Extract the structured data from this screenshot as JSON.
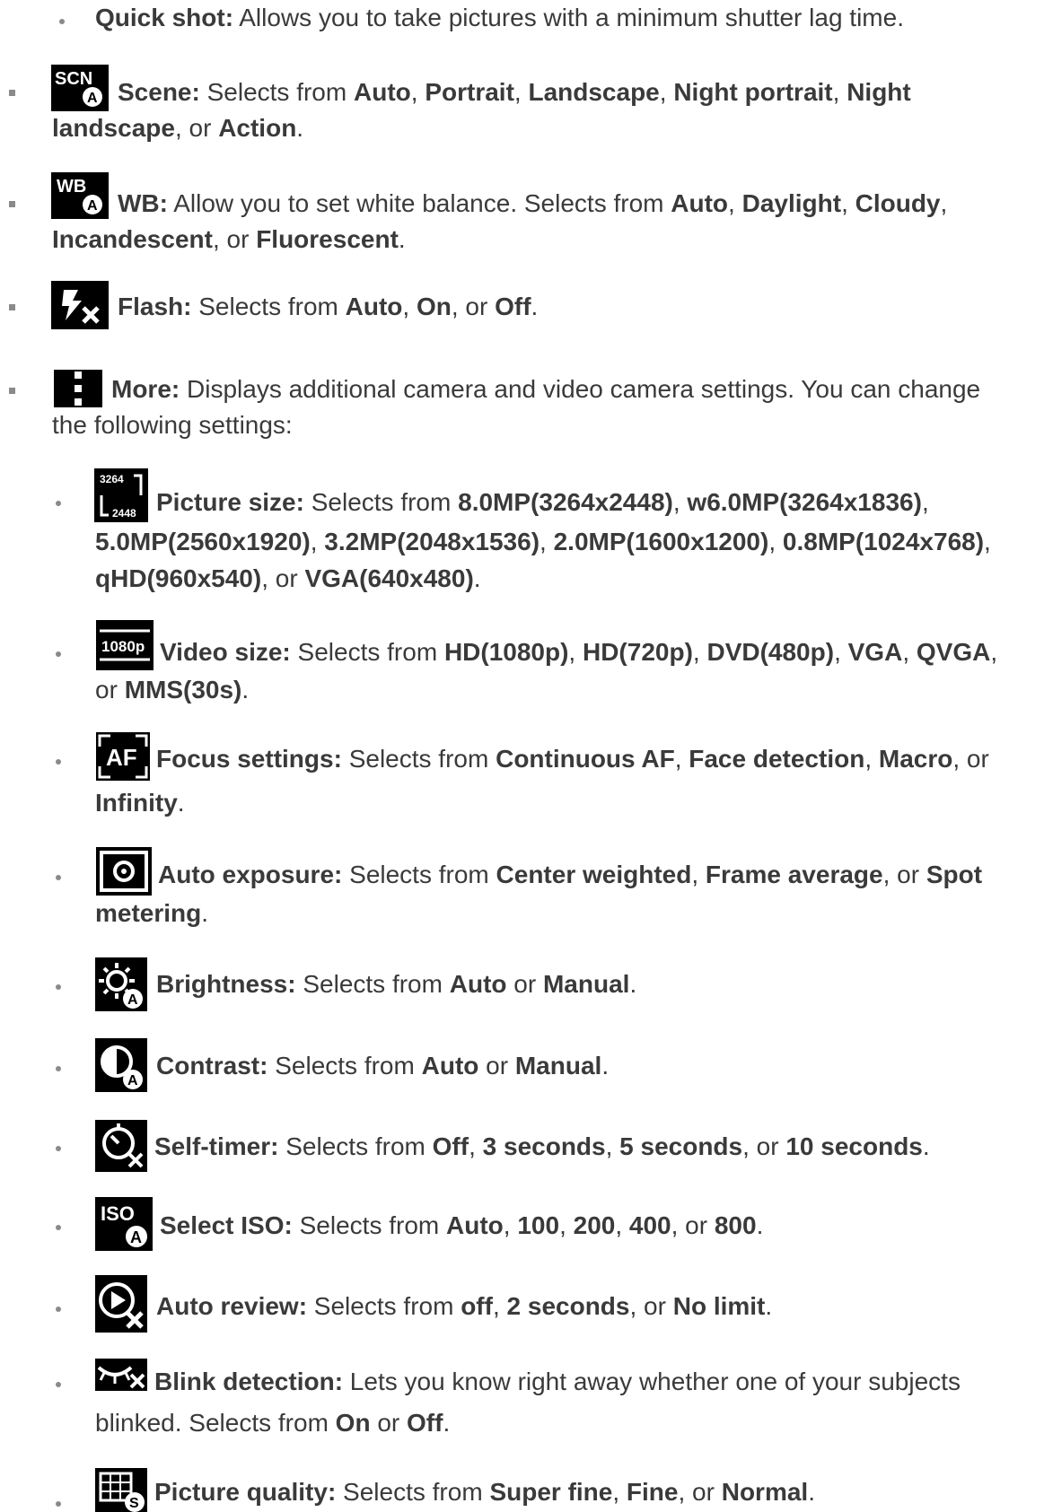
{
  "items": [
    {
      "key": "quick",
      "parts": [
        {
          "b": true,
          "t": "Quick shot:"
        },
        {
          "t": " Allows you to take pictures with a minimum shutter lag time."
        }
      ]
    },
    {
      "key": "scene",
      "icon": "scene-icon",
      "icon_text": "SCN",
      "line1": [
        {
          "b": true,
          "t": "Scene:"
        },
        {
          "t": " Selects from "
        },
        {
          "b": true,
          "t": "Auto"
        },
        {
          "t": ", "
        },
        {
          "b": true,
          "t": "Portrait"
        },
        {
          "t": ", "
        },
        {
          "b": true,
          "t": "Landscape"
        },
        {
          "t": ", "
        },
        {
          "b": true,
          "t": "Night portrait"
        },
        {
          "t": ", "
        },
        {
          "b": true,
          "t": "Night"
        }
      ],
      "line2": [
        {
          "b": true,
          "t": "landscape"
        },
        {
          "t": ", or "
        },
        {
          "b": true,
          "t": "Action"
        },
        {
          "t": "."
        }
      ]
    },
    {
      "key": "wb",
      "icon": "white-balance-icon",
      "icon_text": "WB",
      "line1": [
        {
          "b": true,
          "t": "WB:"
        },
        {
          "t": " Allow you to set white balance. Selects from "
        },
        {
          "b": true,
          "t": "Auto"
        },
        {
          "t": ", "
        },
        {
          "b": true,
          "t": "Daylight"
        },
        {
          "t": ", "
        },
        {
          "b": true,
          "t": "Cloudy"
        },
        {
          "t": ","
        }
      ],
      "line2": [
        {
          "b": true,
          "t": "Incandescent"
        },
        {
          "t": ", or "
        },
        {
          "b": true,
          "t": "Fluorescent"
        },
        {
          "t": "."
        }
      ]
    },
    {
      "key": "flash",
      "icon": "flash-off-icon",
      "line1": [
        {
          "b": true,
          "t": "Flash:"
        },
        {
          "t": " Selects from "
        },
        {
          "b": true,
          "t": "Auto"
        },
        {
          "t": ", "
        },
        {
          "b": true,
          "t": "On"
        },
        {
          "t": ", or "
        },
        {
          "b": true,
          "t": "Off"
        },
        {
          "t": "."
        }
      ]
    },
    {
      "key": "more",
      "icon": "more-vertical-icon",
      "line1": [
        {
          "b": true,
          "t": "More:"
        },
        {
          "t": " Displays additional camera and video camera settings. You can change"
        }
      ],
      "line2": [
        {
          "t": "the following settings:"
        }
      ]
    },
    {
      "key": "picsize",
      "icon": "picture-size-icon",
      "icon_text": "3264",
      "icon_text2": "2448",
      "line1": [
        {
          "b": true,
          "t": "Picture size:"
        },
        {
          "t": " Selects from "
        },
        {
          "b": true,
          "t": "8.0MP(3264x2448)"
        },
        {
          "t": ", "
        },
        {
          "b": true,
          "t": "w6.0MP(3264x1836)"
        },
        {
          "t": ","
        }
      ],
      "line2": [
        {
          "b": true,
          "t": "5.0MP(2560x1920)"
        },
        {
          "t": ", "
        },
        {
          "b": true,
          "t": "3.2MP(2048x1536)"
        },
        {
          "t": ", "
        },
        {
          "b": true,
          "t": "2.0MP(1600x1200)"
        },
        {
          "t": ", "
        },
        {
          "b": true,
          "t": "0.8MP(1024x768)"
        },
        {
          "t": ","
        }
      ],
      "line3": [
        {
          "b": true,
          "t": "qHD(960x540)"
        },
        {
          "t": ", or "
        },
        {
          "b": true,
          "t": "VGA(640x480)"
        },
        {
          "t": "."
        }
      ]
    },
    {
      "key": "vidsize",
      "icon": "video-size-icon",
      "icon_text": "1080p",
      "line1": [
        {
          "b": true,
          "t": "Video size:"
        },
        {
          "t": " Selects from "
        },
        {
          "b": true,
          "t": "HD(1080p)"
        },
        {
          "t": ", "
        },
        {
          "b": true,
          "t": "HD(720p)"
        },
        {
          "t": ", "
        },
        {
          "b": true,
          "t": "DVD(480p)"
        },
        {
          "t": ", "
        },
        {
          "b": true,
          "t": "VGA"
        },
        {
          "t": ", "
        },
        {
          "b": true,
          "t": "QVGA"
        },
        {
          "t": ","
        }
      ],
      "line2": [
        {
          "t": "or "
        },
        {
          "b": true,
          "t": "MMS(30s)"
        },
        {
          "t": "."
        }
      ]
    },
    {
      "key": "focus",
      "icon": "focus-icon",
      "icon_text": "AF",
      "line1": [
        {
          "b": true,
          "t": "Focus settings:"
        },
        {
          "t": " Selects from "
        },
        {
          "b": true,
          "t": "Continuous AF"
        },
        {
          "t": ", "
        },
        {
          "b": true,
          "t": "Face detection"
        },
        {
          "t": ", "
        },
        {
          "b": true,
          "t": "Macro"
        },
        {
          "t": ", or"
        }
      ],
      "line2": [
        {
          "b": true,
          "t": "Infinity"
        },
        {
          "t": "."
        }
      ]
    },
    {
      "key": "exposure",
      "icon": "auto-exposure-icon",
      "line1": [
        {
          "b": true,
          "t": "Auto exposure:"
        },
        {
          "t": " Selects from "
        },
        {
          "b": true,
          "t": "Center weighted"
        },
        {
          "t": ", "
        },
        {
          "b": true,
          "t": "Frame average"
        },
        {
          "t": ", or "
        },
        {
          "b": true,
          "t": "Spot"
        }
      ],
      "line2": [
        {
          "b": true,
          "t": "metering"
        },
        {
          "t": "."
        }
      ]
    },
    {
      "key": "brightness",
      "icon": "brightness-icon",
      "line1": [
        {
          "b": true,
          "t": "Brightness:"
        },
        {
          "t": " Selects from "
        },
        {
          "b": true,
          "t": "Auto"
        },
        {
          "t": " or "
        },
        {
          "b": true,
          "t": "Manual"
        },
        {
          "t": "."
        }
      ]
    },
    {
      "key": "contrast",
      "icon": "contrast-icon",
      "line1": [
        {
          "b": true,
          "t": "Contrast:"
        },
        {
          "t": " Selects from "
        },
        {
          "b": true,
          "t": "Auto"
        },
        {
          "t": " or "
        },
        {
          "b": true,
          "t": "Manual"
        },
        {
          "t": "."
        }
      ]
    },
    {
      "key": "timer",
      "icon": "self-timer-icon",
      "line1": [
        {
          "b": true,
          "t": "Self-timer:"
        },
        {
          "t": " Selects from "
        },
        {
          "b": true,
          "t": "Off"
        },
        {
          "t": ", "
        },
        {
          "b": true,
          "t": "3 seconds"
        },
        {
          "t": ", "
        },
        {
          "b": true,
          "t": "5 seconds"
        },
        {
          "t": ", or "
        },
        {
          "b": true,
          "t": "10 seconds"
        },
        {
          "t": "."
        }
      ]
    },
    {
      "key": "iso",
      "icon": "iso-icon",
      "icon_text": "ISO",
      "line1": [
        {
          "b": true,
          "t": "Select ISO:"
        },
        {
          "t": " Selects from "
        },
        {
          "b": true,
          "t": "Auto"
        },
        {
          "t": ", "
        },
        {
          "b": true,
          "t": "100"
        },
        {
          "t": ", "
        },
        {
          "b": true,
          "t": "200"
        },
        {
          "t": ", "
        },
        {
          "b": true,
          "t": "400"
        },
        {
          "t": ", or "
        },
        {
          "b": true,
          "t": "800"
        },
        {
          "t": "."
        }
      ]
    },
    {
      "key": "review",
      "icon": "auto-review-icon",
      "line1": [
        {
          "b": true,
          "t": "Auto review:"
        },
        {
          "t": " Selects from "
        },
        {
          "b": true,
          "t": "off"
        },
        {
          "t": ", "
        },
        {
          "b": true,
          "t": "2 seconds"
        },
        {
          "t": ", or "
        },
        {
          "b": true,
          "t": "No limit"
        },
        {
          "t": "."
        }
      ]
    },
    {
      "key": "blink",
      "icon": "blink-detection-icon",
      "line1": [
        {
          "b": true,
          "t": "Blink detection:"
        },
        {
          "t": " Lets you know right away whether one of your subjects"
        }
      ],
      "line2": [
        {
          "t": "blinked. Selects from "
        },
        {
          "b": true,
          "t": "On"
        },
        {
          "t": " or "
        },
        {
          "b": true,
          "t": "Off"
        },
        {
          "t": "."
        }
      ]
    },
    {
      "key": "quality",
      "icon": "picture-quality-icon",
      "line1": [
        {
          "b": true,
          "t": "Picture quality:"
        },
        {
          "t": " Selects from "
        },
        {
          "b": true,
          "t": "Super fine"
        },
        {
          "t": ", "
        },
        {
          "b": true,
          "t": "Fine"
        },
        {
          "t": ", or "
        },
        {
          "b": true,
          "t": "Normal"
        },
        {
          "t": "."
        }
      ]
    }
  ]
}
